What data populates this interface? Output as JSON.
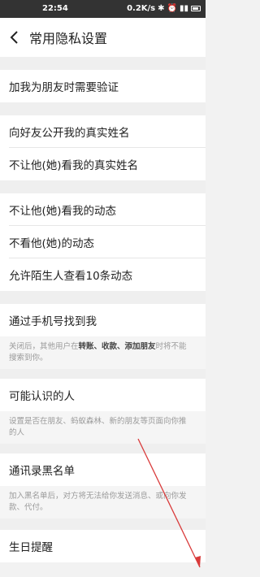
{
  "status": {
    "time": "22:54",
    "net_speed": "0.2K/s"
  },
  "header": {
    "title": "常用隐私设置"
  },
  "rows": {
    "verify": "加我为朋友时需要验证",
    "real_name_public": "向好友公开我的真实姓名",
    "hide_real_name": "不让他(她)看我的真实姓名",
    "hide_my_feed": "不让他(她)看我的动态",
    "not_see_feed": "不看他(她)的动态",
    "stranger_feed": "允许陌生人查看10条动态",
    "find_by_phone": "通过手机号找到我",
    "maybe_know": "可能认识的人",
    "contact_blacklist": "通讯录黑名单",
    "birthday": "生日提醒"
  },
  "descriptions": {
    "phone": {
      "part1": "关闭后，其他用户在",
      "b1": "转账、收款、添加朋友",
      "part2": "时将不能",
      "line2": "搜索到你。"
    },
    "maybe_know": {
      "line1": "设置是否在朋友、蚂蚁森林、新的朋友等页面向你推",
      "line2": "的人"
    },
    "blacklist": {
      "line1": "加入黑名单后，对方将无法给你发送消息、或向你发",
      "line2": "款、代付。"
    }
  },
  "colors": {
    "annotation_arrow": "#d93a3a"
  }
}
